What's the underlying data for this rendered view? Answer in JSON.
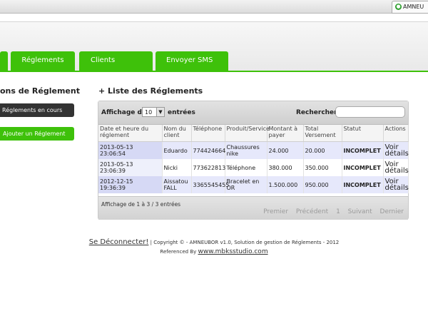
{
  "browser": {
    "tab_title": "AMNEU"
  },
  "nav": {
    "tabs": [
      "Réglements",
      "Clients",
      "Envoyer SMS"
    ]
  },
  "sidebar": {
    "title": "ons de Réglement",
    "items": [
      {
        "label": "Réglements en cours",
        "color": "#333333"
      },
      {
        "label": "Ajouter un Réglement",
        "color": "#3ec10a"
      }
    ]
  },
  "main": {
    "title": "+ Liste des Réglements",
    "show_label": "Affichage de",
    "page_length": "10",
    "entries_label": "entrées",
    "search_label": "Rechercher:",
    "search_value": "",
    "columns": [
      "Date et heure du réglement",
      "Nom du client",
      "Téléphone",
      "Produit/Service",
      "Montant à payer",
      "Total Versement",
      "Statut",
      "Actions"
    ],
    "rows": [
      [
        "2013-05-13 23:06:54",
        "Eduardo",
        "774424664",
        "Chaussures nike",
        "24.000",
        "20.000",
        "INCOMPLET",
        "Voir détails"
      ],
      [
        "2013-05-13 23:06:39",
        "Nicki",
        "773622813",
        "Téléphone",
        "380.000",
        "350.000",
        "INCOMPLET",
        "Voir détails"
      ],
      [
        "2012-12-15 19:36:39",
        "Aissatou FALL",
        "3365545455",
        "Bracelet en OR",
        "1.500.000",
        "950.000",
        "INCOMPLET",
        "Voir détails"
      ]
    ],
    "info": "Affichage de 1 à 3 / 3 entrées",
    "pager": {
      "first": "Premier",
      "prev": "Précédent",
      "page": "1",
      "next": "Suivant",
      "last": "Dernier"
    }
  },
  "footer": {
    "logout": "Se Déconnecter!",
    "copyright": "| Copyright © - AMNEUBOR v1.0, Solution de gestion de Réglements - 2012",
    "ref_label": "Referenced By",
    "ref_link": "www.mbksstudio.com"
  },
  "colors": {
    "accent": "#3ec10a",
    "status": "#e10000"
  }
}
